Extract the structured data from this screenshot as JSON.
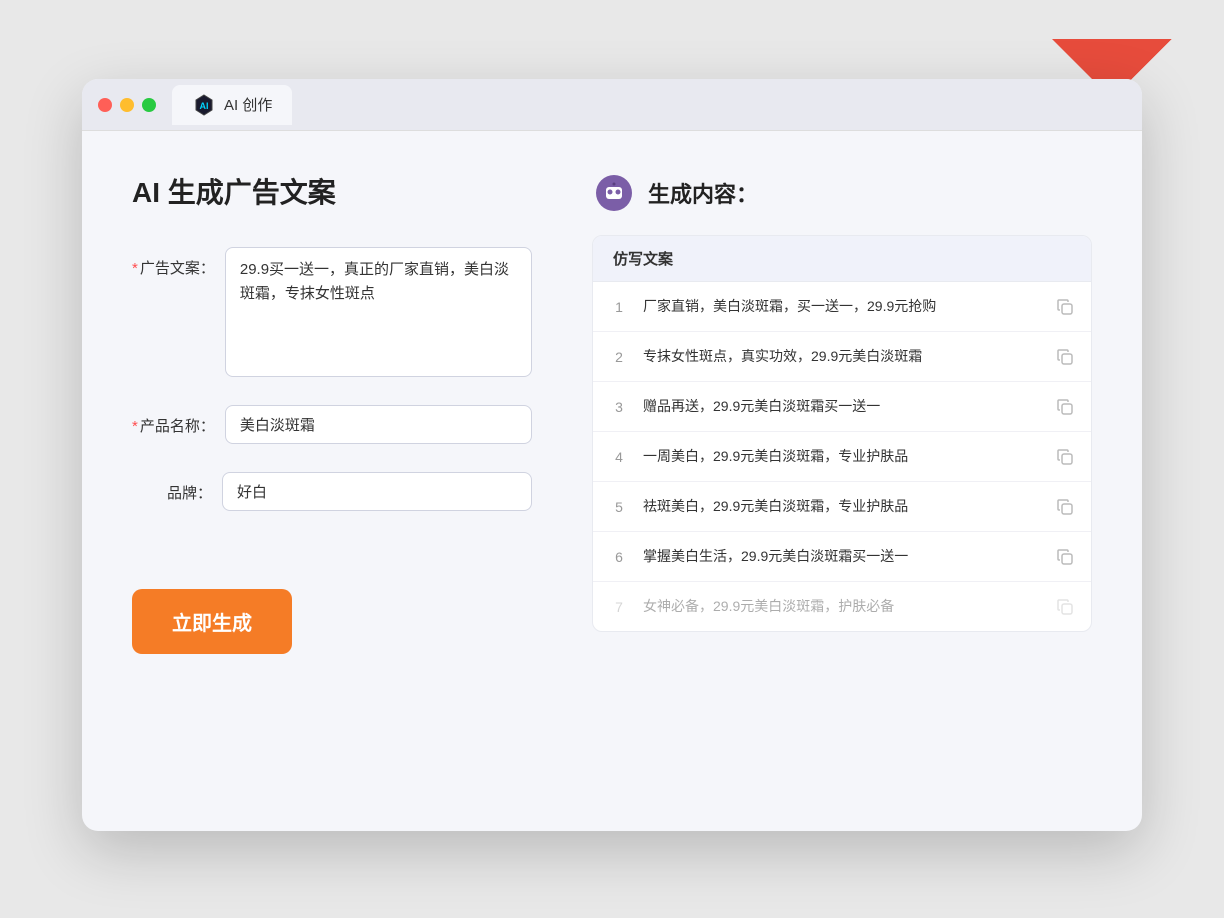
{
  "window": {
    "tab_label": "AI 创作"
  },
  "page": {
    "title": "AI 生成广告文案"
  },
  "form": {
    "ad_copy_label": "广告文案：",
    "ad_copy_required": "*",
    "ad_copy_value": "29.9买一送一，真正的厂家直销，美白淡斑霜，专抹女性斑点",
    "product_name_label": "产品名称：",
    "product_name_required": "*",
    "product_name_value": "美白淡斑霜",
    "brand_label": "品牌：",
    "brand_value": "好白",
    "generate_btn_label": "立即生成"
  },
  "result": {
    "header_label": "生成内容：",
    "table_header": "仿写文案",
    "items": [
      {
        "num": "1",
        "text": "厂家直销，美白淡斑霜，买一送一，29.9元抢购",
        "dimmed": false
      },
      {
        "num": "2",
        "text": "专抹女性斑点，真实功效，29.9元美白淡斑霜",
        "dimmed": false
      },
      {
        "num": "3",
        "text": "赠品再送，29.9元美白淡斑霜买一送一",
        "dimmed": false
      },
      {
        "num": "4",
        "text": "一周美白，29.9元美白淡斑霜，专业护肤品",
        "dimmed": false
      },
      {
        "num": "5",
        "text": "祛斑美白，29.9元美白淡斑霜，专业护肤品",
        "dimmed": false
      },
      {
        "num": "6",
        "text": "掌握美白生活，29.9元美白淡斑霜买一送一",
        "dimmed": false
      },
      {
        "num": "7",
        "text": "女神必备，29.9元美白淡斑霜，护肤必备",
        "dimmed": true
      }
    ]
  }
}
